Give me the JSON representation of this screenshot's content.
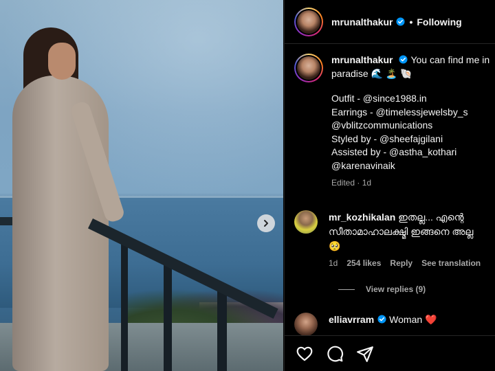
{
  "post": {
    "author": "mrunalthakur",
    "follow_state": "Following",
    "separator": "•",
    "caption_lines": [
      "You can find me in",
      "paradise 🌊 🏝️ 🐚",
      "",
      "Outfit - @since1988.in",
      "Earrings - @timelessjewelsby_s",
      "@vblitzcommunications",
      "Styled by - @sheefajgilani",
      "Assisted by - @astha_kothari",
      "@karenavinaik"
    ],
    "caption_meta": "Edited · 1d"
  },
  "comments": [
    {
      "username": "mr_kozhikalan",
      "text": "ഇതല്ല... എന്റെ സീതാമാഹാലക്ഷ്മി ഇങ്ങനെ അല്ല 🥺",
      "time": "1d",
      "likes": "254 likes",
      "reply": "Reply",
      "translate": "See translation",
      "view_replies": "View replies (9)"
    },
    {
      "username": "elliavrram",
      "text": "Woman ❤️"
    }
  ],
  "colors": {
    "background": "#000000",
    "text": "#f5f5f5",
    "muted": "#a8a8a8",
    "verified": "#0095f6",
    "divider": "#262626"
  },
  "icons": {
    "carousel_next": "chevron-right-icon",
    "like": "heart-icon",
    "comment": "comment-bubble-icon",
    "share": "paper-plane-icon",
    "verified": "verified-badge-icon"
  }
}
